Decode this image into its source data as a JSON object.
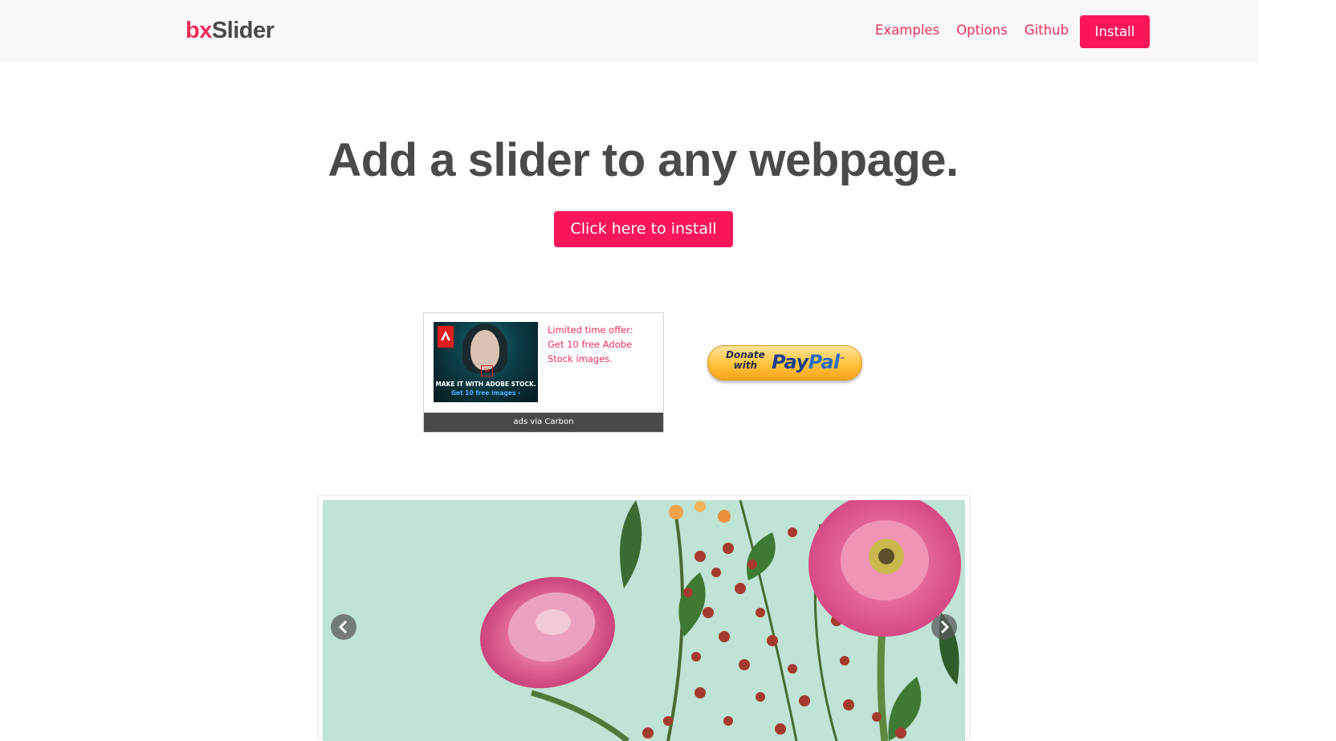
{
  "header": {
    "logo_prefix": "bx",
    "logo_suffix": "Slider",
    "nav": [
      "Examples",
      "Options",
      "Github"
    ],
    "install_label": "Install"
  },
  "hero": {
    "title": "Add a slider to any webpage.",
    "cta_label": "Click here to install"
  },
  "ad": {
    "image_caption_line1": "MAKE IT WITH ADOBE STOCK.",
    "image_caption_line2": "Get 10 free images ›",
    "text": "Limited time offer: Get 10 free Adobe Stock images.",
    "footer": "ads via Carbon"
  },
  "paypal": {
    "donate": "Donate",
    "with": "with",
    "brand_pay": "Pay",
    "brand_pal": "Pal"
  },
  "slider": {
    "prev_icon": "chevron-left-icon",
    "next_icon": "chevron-right-icon"
  },
  "colors": {
    "accent": "#fa1659",
    "link": "#ee2e5c",
    "text": "#4a4a4a",
    "topbar": "#f8f8f8"
  }
}
